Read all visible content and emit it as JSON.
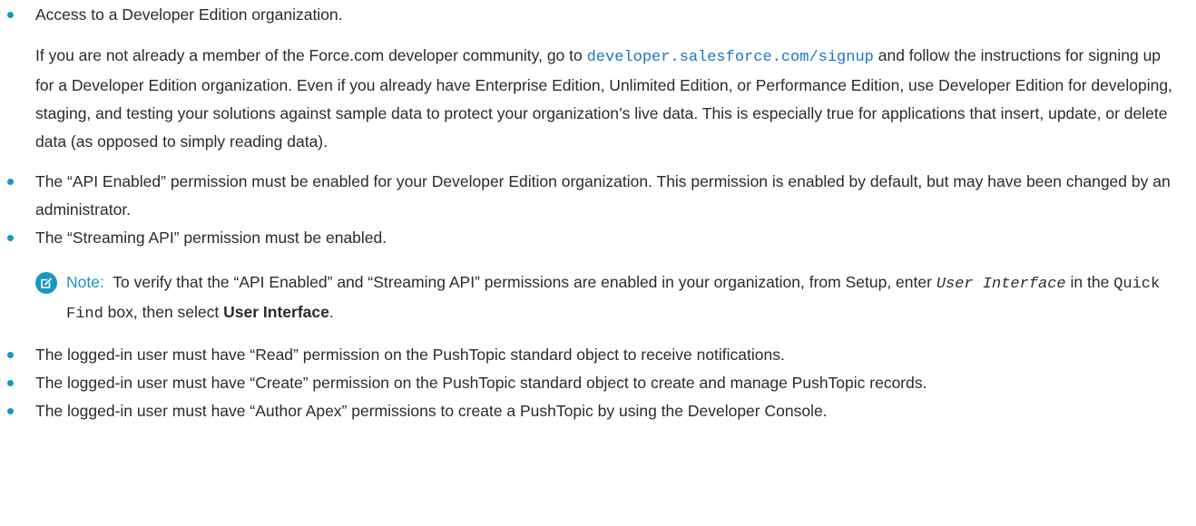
{
  "requirements": {
    "item1": {
      "text": "Access to a Developer Edition organization.",
      "para_before_link": "If you are not already a member of the Force.com developer community, go to ",
      "link_text": "developer.salesforce.com/signup",
      "para_after_link": " and follow the instructions for signing up for a Developer Edition organization. Even if you already have Enterprise Edition, Unlimited Edition, or Performance Edition, use Developer Edition for developing, staging, and testing your solutions against sample data to protect your organization’s live data. This is especially true for applications that insert, update, or delete data (as opposed to simply reading data)."
    },
    "item2": "The “API Enabled” permission must be enabled for your Developer Edition organization. This permission is enabled by default, but may have been changed by an administrator.",
    "item3": "The “Streaming API” permission must be enabled.",
    "note": {
      "label": "Note:",
      "text_before": "To verify that the “API Enabled” and “Streaming API” permissions are enabled in your organization, from Setup, enter ",
      "code_user_interface": "User Interface",
      "text_in_the": " in the ",
      "code_quick_find": "Quick Find",
      "text_box_select": " box, then select ",
      "bold_user_interface": "User Interface",
      "text_end": "."
    },
    "item4": "The logged-in user must have “Read” permission on the PushTopic standard object to receive notifications.",
    "item5": "The logged-in user must have “Create” permission on the PushTopic standard object to create and manage PushTopic records.",
    "item6": "The logged-in user must have “Author Apex” permissions to create a PushTopic by using the Developer Console."
  },
  "colors": {
    "bullet": "#1798c1",
    "link": "#1b75c9",
    "note_accent": "#1798c1",
    "text": "#2b2b2b"
  },
  "icons": {
    "note": "note-edit-icon"
  }
}
